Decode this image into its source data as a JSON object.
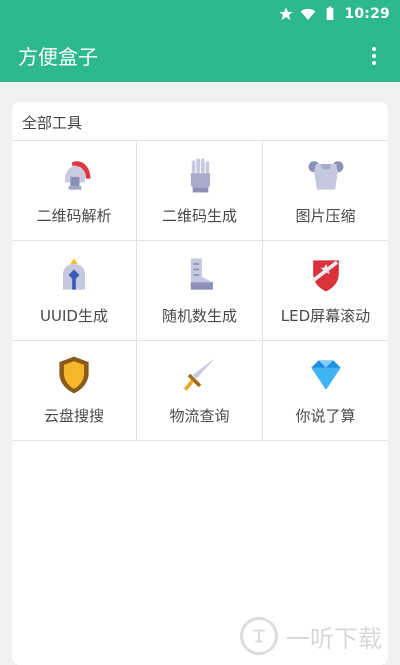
{
  "status_bar": {
    "time": "10:29",
    "icons": [
      "star-icon",
      "wifi-icon",
      "battery-icon"
    ]
  },
  "app_bar": {
    "title": "方便盒子",
    "menu_icon": "more-vertical-icon",
    "color": "#2db88f"
  },
  "section": {
    "title": "全部工具"
  },
  "tools": [
    {
      "label": "二维码解析",
      "icon": "spartan-helmet-icon"
    },
    {
      "label": "二维码生成",
      "icon": "armored-glove-icon"
    },
    {
      "label": "图片压缩",
      "icon": "chest-armor-icon"
    },
    {
      "label": "UUID生成",
      "icon": "knight-helmet-icon"
    },
    {
      "label": "随机数生成",
      "icon": "armored-boot-icon"
    },
    {
      "label": "LED屏幕滚动",
      "icon": "red-shield-icon"
    },
    {
      "label": "云盘搜搜",
      "icon": "gold-shield-icon"
    },
    {
      "label": "物流查询",
      "icon": "sword-icon"
    },
    {
      "label": "你说了算",
      "icon": "blue-gem-icon"
    }
  ],
  "watermark": {
    "text": "一听下载",
    "icon": "ting-logo-icon"
  }
}
